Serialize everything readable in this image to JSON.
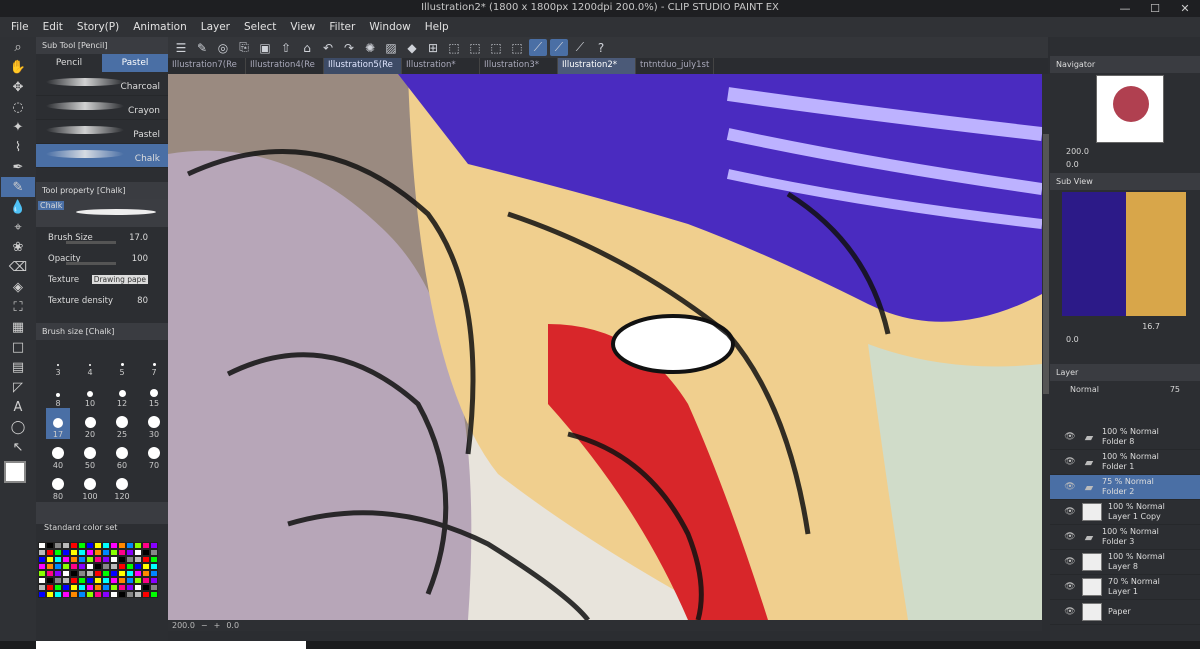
{
  "window": {
    "title": "Illustration2* (1800 x 1800px 1200dpi 200.0%) - CLIP STUDIO PAINT EX",
    "minimize": "—",
    "maximize": "☐",
    "close": "✕"
  },
  "menu": [
    "File",
    "Edit",
    "Story(P)",
    "Animation",
    "Layer",
    "Select",
    "View",
    "Filter",
    "Window",
    "Help"
  ],
  "tabs": [
    "Illustration7(Re",
    "Illustration4(Re",
    "Illustration5(Re",
    "Illustration*",
    "Illustration3*",
    "Illustration2*",
    "tntntduo_july1st"
  ],
  "subtool": {
    "header": "Sub Tool [Pencil]",
    "tab1": "Pencil",
    "tab2": "Pastel",
    "brushes": [
      "Charcoal",
      "Crayon",
      "Pastel",
      "Chalk"
    ]
  },
  "toolprop": {
    "header": "Tool property [Chalk]",
    "preview_label": "Chalk",
    "brush_size_label": "Brush Size",
    "brush_size": "17.0",
    "opacity_label": "Opacity",
    "opacity": "100",
    "texture_label": "Texture",
    "texture": "Drawing pape",
    "density_label": "Texture density",
    "density": "80"
  },
  "brushsize": {
    "header": "Brush size [Chalk]",
    "sizes": [
      "3",
      "4",
      "5",
      "7",
      "8",
      "10",
      "12",
      "15",
      "17",
      "20",
      "25",
      "30",
      "40",
      "50",
      "60",
      "70",
      "80",
      "100",
      "120"
    ]
  },
  "colorset": {
    "label": "Standard color set"
  },
  "navigator": {
    "header": "Navigator",
    "zoom": "200.0",
    "angle": "0.0"
  },
  "subview": {
    "header": "Sub View",
    "zoom": "16.7",
    "angle": "0.0"
  },
  "layerpanel": {
    "header": "Layer",
    "blend": "Normal",
    "opacity": "75"
  },
  "layers": [
    {
      "pct": "100 %",
      "mode": "Normal",
      "name": "Folder 8",
      "kind": "folder"
    },
    {
      "pct": "100 %",
      "mode": "Normal",
      "name": "Folder 1",
      "kind": "folder"
    },
    {
      "pct": "75 %",
      "mode": "Normal",
      "name": "Folder 2",
      "kind": "folder",
      "selected": true
    },
    {
      "pct": "100 %",
      "mode": "Normal",
      "name": "Layer 1 Copy",
      "kind": "layer"
    },
    {
      "pct": "100 %",
      "mode": "Normal",
      "name": "Folder 3",
      "kind": "folder"
    },
    {
      "pct": "100 %",
      "mode": "Normal",
      "name": "Layer 8",
      "kind": "layer"
    },
    {
      "pct": "70 %",
      "mode": "Normal",
      "name": "Layer 1",
      "kind": "layer"
    },
    {
      "pct": "",
      "mode": "",
      "name": "Paper",
      "kind": "paper"
    }
  ],
  "status": {
    "zoom": "200.0",
    "angle": "0.0"
  },
  "colors": {
    "accent": "#4a6fa5",
    "hair": "#4a2bc0",
    "blood": "#d8262a",
    "skin": "#f0cf8e"
  },
  "icons": [
    "menu-icon",
    "pen-icon",
    "undo-icon",
    "redo-icon",
    "transform-icon",
    "ruler-icon",
    "help-icon"
  ]
}
